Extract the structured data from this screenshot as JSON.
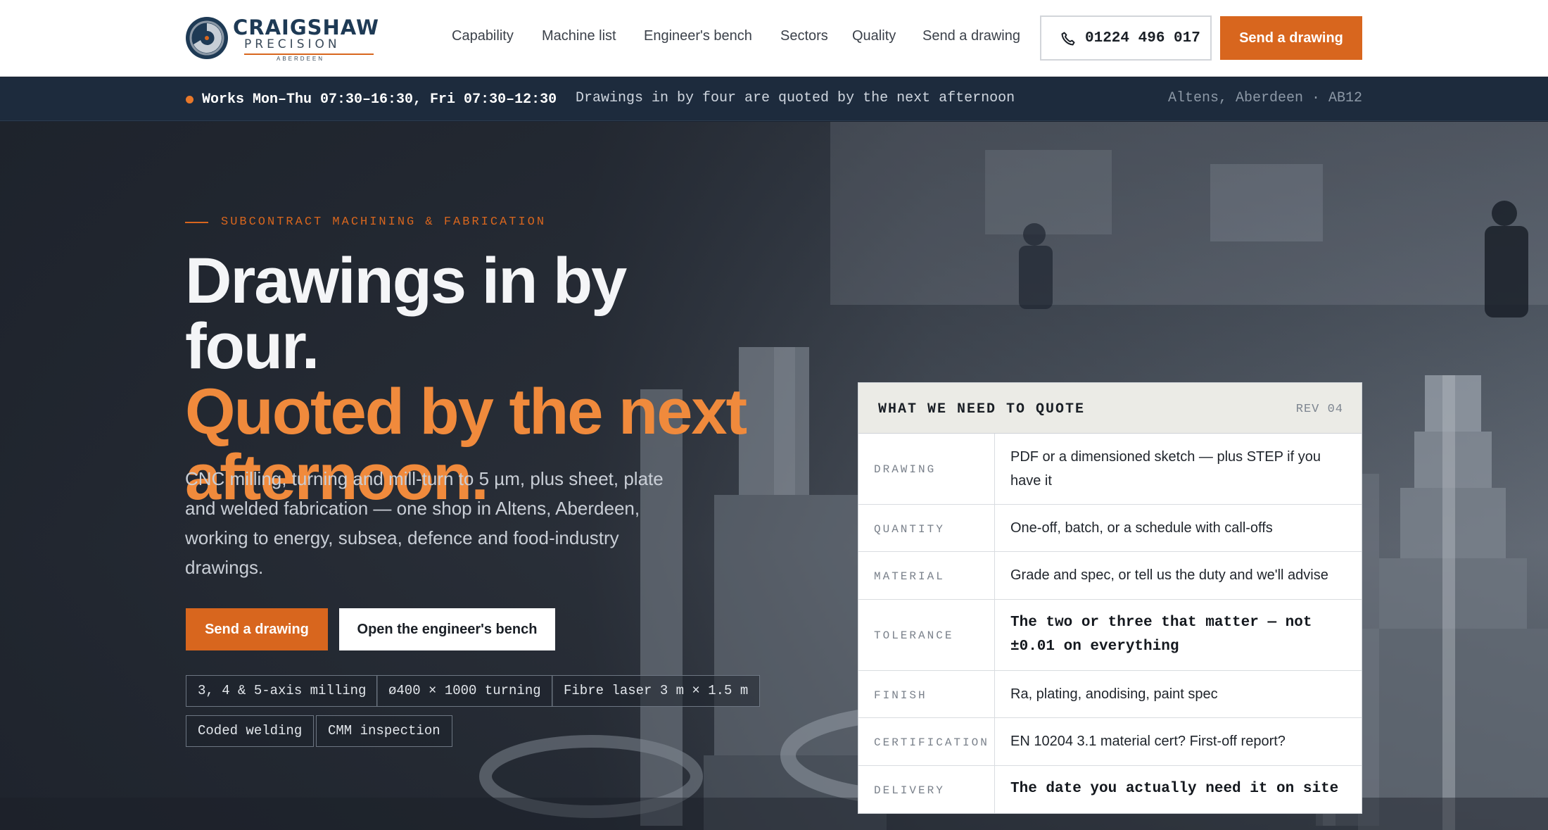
{
  "brand": {
    "name": "CRAIGSHAW",
    "sub": "PRECISION",
    "city": "ABERDEEN",
    "accent": "#d8661e",
    "navy": "#1e3a55"
  },
  "nav": {
    "items": [
      "Capability",
      "Machine list",
      "Engineer's bench",
      "Sectors",
      "Quality",
      "Send a drawing"
    ],
    "phone": "01224 496 017",
    "phone_icon": "phone-icon",
    "cta": "Send a drawing"
  },
  "infobar": {
    "hours": "Works Mon–Thu 07:30–16:30, Fri 07:30–12:30",
    "tagline": "Drawings in by four are quoted by the next afternoon",
    "location": "Altens, Aberdeen · AB12"
  },
  "hero": {
    "eyebrow": "SUBCONTRACT MACHINING & FABRICATION",
    "title_line1": "Drawings in by four.",
    "title_line2": "Quoted by the next afternoon.",
    "lead": "CNC milling, turning and mill-turn to 5 µm, plus sheet, plate and welded fabrication — one shop in Altens, Aberdeen, working to energy, subsea, defence and food-industry drawings.",
    "primary_cta": "Send a drawing",
    "secondary_cta": "Open the engineer's bench",
    "chips": [
      "3, 4 & 5-axis milling",
      "ø400 × 1000 turning",
      "Fibre laser 3 m × 1.5 m",
      "Coded welding",
      "CMM inspection"
    ]
  },
  "quote_card": {
    "title": "WHAT WE NEED TO QUOTE",
    "rev": "REV 04",
    "rows": [
      {
        "key": "DRAWING",
        "value": "PDF or a dimensioned sketch — plus STEP if you have it"
      },
      {
        "key": "QUANTITY",
        "value": "One-off, batch, or a schedule with call-offs"
      },
      {
        "key": "MATERIAL",
        "value": "Grade and spec, or tell us the duty and we'll advise"
      },
      {
        "key": "TOLERANCE",
        "value": "The two or three that matter — not ±0.01 on everything"
      },
      {
        "key": "FINISH",
        "value": "Ra, plating, anodising, paint spec"
      },
      {
        "key": "CERTIFICATION",
        "value": "EN 10204 3.1 material cert? First-off report?"
      },
      {
        "key": "DELIVERY",
        "value": "The date you actually need it on site"
      }
    ]
  }
}
